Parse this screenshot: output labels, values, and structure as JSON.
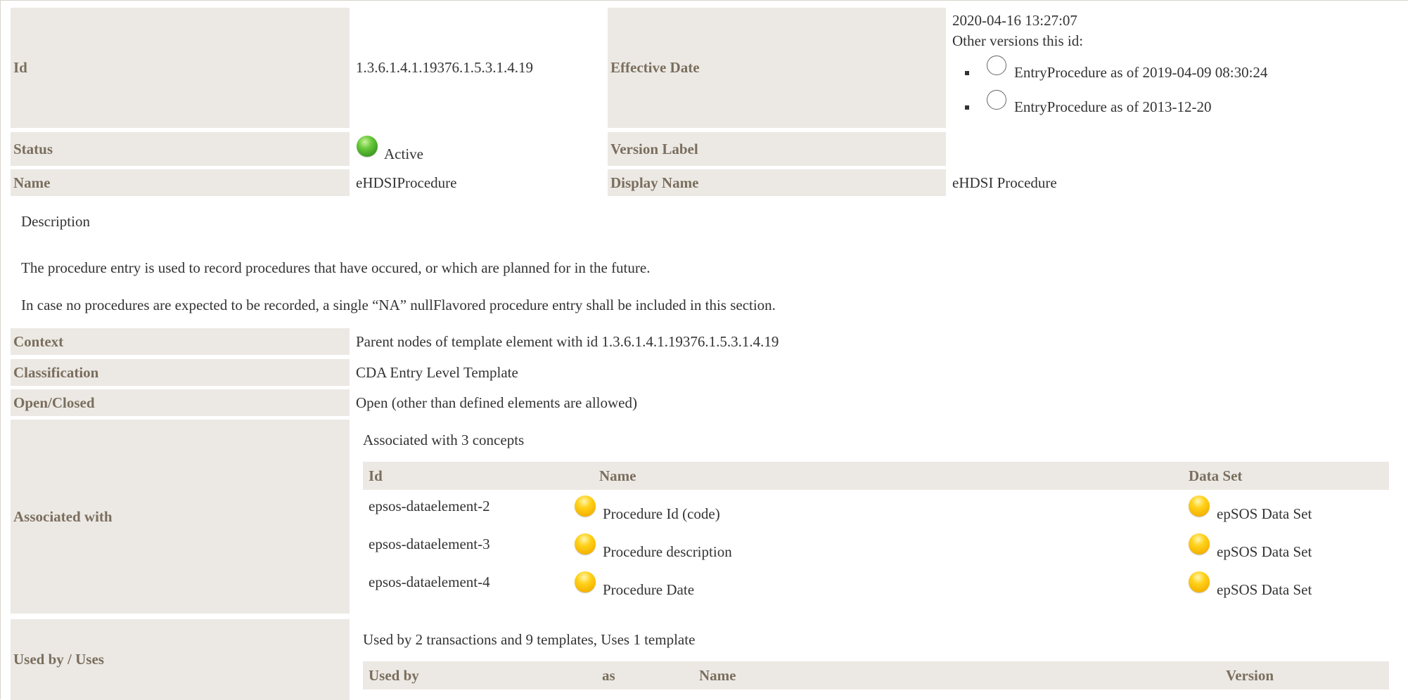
{
  "header": {
    "id_label": "Id",
    "id_value": "1.3.6.1.4.1.19376.1.5.3.1.4.19",
    "effective_date_label": "Effective Date",
    "effective_date_value": "2020-04-16 13:27:07",
    "other_versions_label": "Other versions this id:",
    "other_versions": [
      {
        "label": "EntryProcedure as of 2019-04-09 08:30:24"
      },
      {
        "label": "EntryProcedure as of 2013-12-20"
      }
    ],
    "status_label": "Status",
    "status_value": "Active",
    "version_label_label": "Version Label",
    "version_label_value": "",
    "name_label": "Name",
    "name_value": "eHDSIProcedure",
    "display_name_label": "Display Name",
    "display_name_value": "eHDSI Procedure"
  },
  "description": {
    "title": "Description",
    "paragraphs": [
      "The procedure entry is used to record procedures that have occured, or which are planned for in the future.",
      "In case no procedures are expected to be recorded, a single “NA” nullFlavored procedure entry shall be included in this section."
    ]
  },
  "details": {
    "context_label": "Context",
    "context_value": "Parent nodes of template element with id 1.3.6.1.4.1.19376.1.5.3.1.4.19",
    "classification_label": "Classification",
    "classification_value": "CDA Entry Level Template",
    "open_closed_label": "Open/Closed",
    "open_closed_value": "Open (other than defined elements are allowed)"
  },
  "associated": {
    "label": "Associated with",
    "summary": "Associated with 3 concepts",
    "columns": [
      "Id",
      "Name",
      "Data Set"
    ],
    "rows": [
      {
        "id": "epsos-dataelement-2",
        "name": "Procedure Id (code)",
        "dataset": "epSOS Data Set"
      },
      {
        "id": "epsos-dataelement-3",
        "name": "Procedure description",
        "dataset": "epSOS Data Set"
      },
      {
        "id": "epsos-dataelement-4",
        "name": "Procedure Date",
        "dataset": "epSOS Data Set"
      }
    ]
  },
  "used_by": {
    "label": "Used by / Uses",
    "summary": "Used by 2 transactions and 9 templates, Uses 1 template",
    "columns": [
      "Used by",
      "as",
      "Name",
      "Version"
    ]
  },
  "colors": {
    "label_bg": "#ece9e4",
    "label_text": "#7a6e5e",
    "status_active": "#4caf2a",
    "concept_dot": "#ffc107"
  }
}
